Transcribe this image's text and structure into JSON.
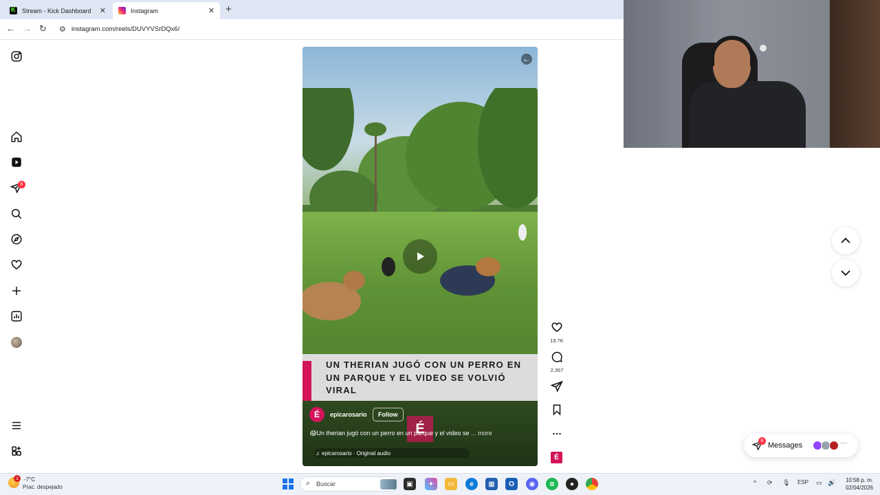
{
  "browser": {
    "tabs": [
      {
        "label": "Stream - Kick Dashboard",
        "active": false
      },
      {
        "label": "Instagram",
        "active": true
      }
    ],
    "url": "instagram.com/reels/DUVYVSrDQx6/"
  },
  "sidebar": {
    "notification_count": "6"
  },
  "reel": {
    "headline": "UN THERIAN JUGÓ CON UN PERRO EN UN PARQUE Y EL VIDEO SE VOLVIÓ VIRAL",
    "account_logo": "É",
    "account_name": "epicarosario",
    "follow_label": "Follow",
    "caption_prefix": "😱",
    "caption": "Un therian jugó con un perro en un parque y el video se",
    "caption_ellipsis": "...",
    "more_label": "more",
    "audio": "epicarosario · Original audio",
    "watermark": "É"
  },
  "actions": {
    "likes": "19.7K",
    "comments": "2,357"
  },
  "messages": {
    "label": "Messages",
    "badge": "6"
  },
  "taskbar": {
    "weather_badge": "2",
    "temperature": "-7°C",
    "weather_desc": "Prac. despejado",
    "search_placeholder": "Buscar",
    "language": "ESP",
    "time": "10:58 p. m.",
    "date": "02/04/2026"
  },
  "colors": {
    "brand_accent": "#d4145a",
    "notification_red": "#ff3040",
    "tabbar_bg": "#dfe6f3"
  }
}
